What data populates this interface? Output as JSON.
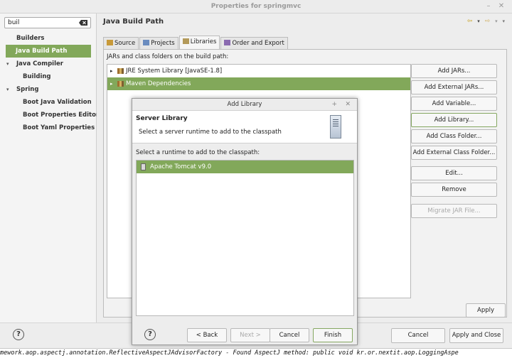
{
  "window": {
    "title": "Properties for springmvc"
  },
  "filter": {
    "value": "buil"
  },
  "tree": [
    {
      "label": "Builders",
      "indent": 0,
      "twisty": "",
      "selected": false
    },
    {
      "label": "Java Build Path",
      "indent": 0,
      "twisty": "",
      "selected": true
    },
    {
      "label": "Java Compiler",
      "indent": 0,
      "twisty": "▾",
      "selected": false
    },
    {
      "label": "Building",
      "indent": 1,
      "twisty": "",
      "selected": false
    },
    {
      "label": "Spring",
      "indent": 0,
      "twisty": "▾",
      "selected": false
    },
    {
      "label": "Boot Java Validation",
      "indent": 1,
      "twisty": "",
      "selected": false
    },
    {
      "label": "Boot Properties Editor",
      "indent": 1,
      "twisty": "",
      "selected": false
    },
    {
      "label": "Boot Yaml Properties E",
      "indent": 1,
      "twisty": "",
      "selected": false
    }
  ],
  "page": {
    "title": "Java Build Path"
  },
  "tabs": [
    {
      "label": "Source",
      "active": false
    },
    {
      "label": "Projects",
      "active": false
    },
    {
      "label": "Libraries",
      "active": true
    },
    {
      "label": "Order and Export",
      "active": false
    }
  ],
  "libraries": {
    "label": "JARs and class folders on the build path:",
    "items": [
      {
        "label": "JRE System Library [JavaSE-1.8]",
        "twisty": "▸",
        "selected": false
      },
      {
        "label": "Maven Dependencies",
        "twisty": "▸",
        "selected": true
      }
    ]
  },
  "side_buttons": [
    {
      "label": "Add JARs...",
      "state": ""
    },
    {
      "label": "Add External JARs...",
      "state": ""
    },
    {
      "label": "Add Variable...",
      "state": ""
    },
    {
      "label": "Add Library...",
      "state": "focus"
    },
    {
      "label": "Add Class Folder...",
      "state": ""
    },
    {
      "label": "Add External Class Folder...",
      "state": ""
    },
    {
      "label": "Edit...",
      "state": ""
    },
    {
      "label": "Remove",
      "state": ""
    },
    {
      "label": "Migrate JAR File...",
      "state": "disabled"
    }
  ],
  "apply_label": "Apply",
  "bottom": {
    "help": "?",
    "cancel": "Cancel",
    "apply_close": "Apply and Close"
  },
  "console_text": "mework.aop.aspectj.annotation.ReflectiveAspectJAdvisorFactory - Found AspectJ method: public void kr.or.nextit.aop.LoggingAspe",
  "dialog": {
    "title": "Add Library",
    "heading": "Server Library",
    "description": "Select a server runtime to add to the classpath",
    "list_label": "Select a runtime to add to the classpath:",
    "items": [
      {
        "label": "Apache Tomcat v9.0"
      }
    ],
    "help": "?",
    "back": "< Back",
    "next": "Next >",
    "cancel": "Cancel",
    "finish": "Finish"
  },
  "colors": {
    "selection": "#82a85a",
    "background": "#ededed"
  },
  "icons": {
    "filter_clear": "clear-icon",
    "nav": [
      "back-arrow-icon",
      "forward-arrow-icon",
      "menu-icon"
    ],
    "tabs": [
      "source-icon",
      "projects-icon",
      "libraries-icon",
      "order-icon"
    ],
    "library": "library-icon",
    "server": "server-icon",
    "runtime": "tomcat-icon"
  }
}
